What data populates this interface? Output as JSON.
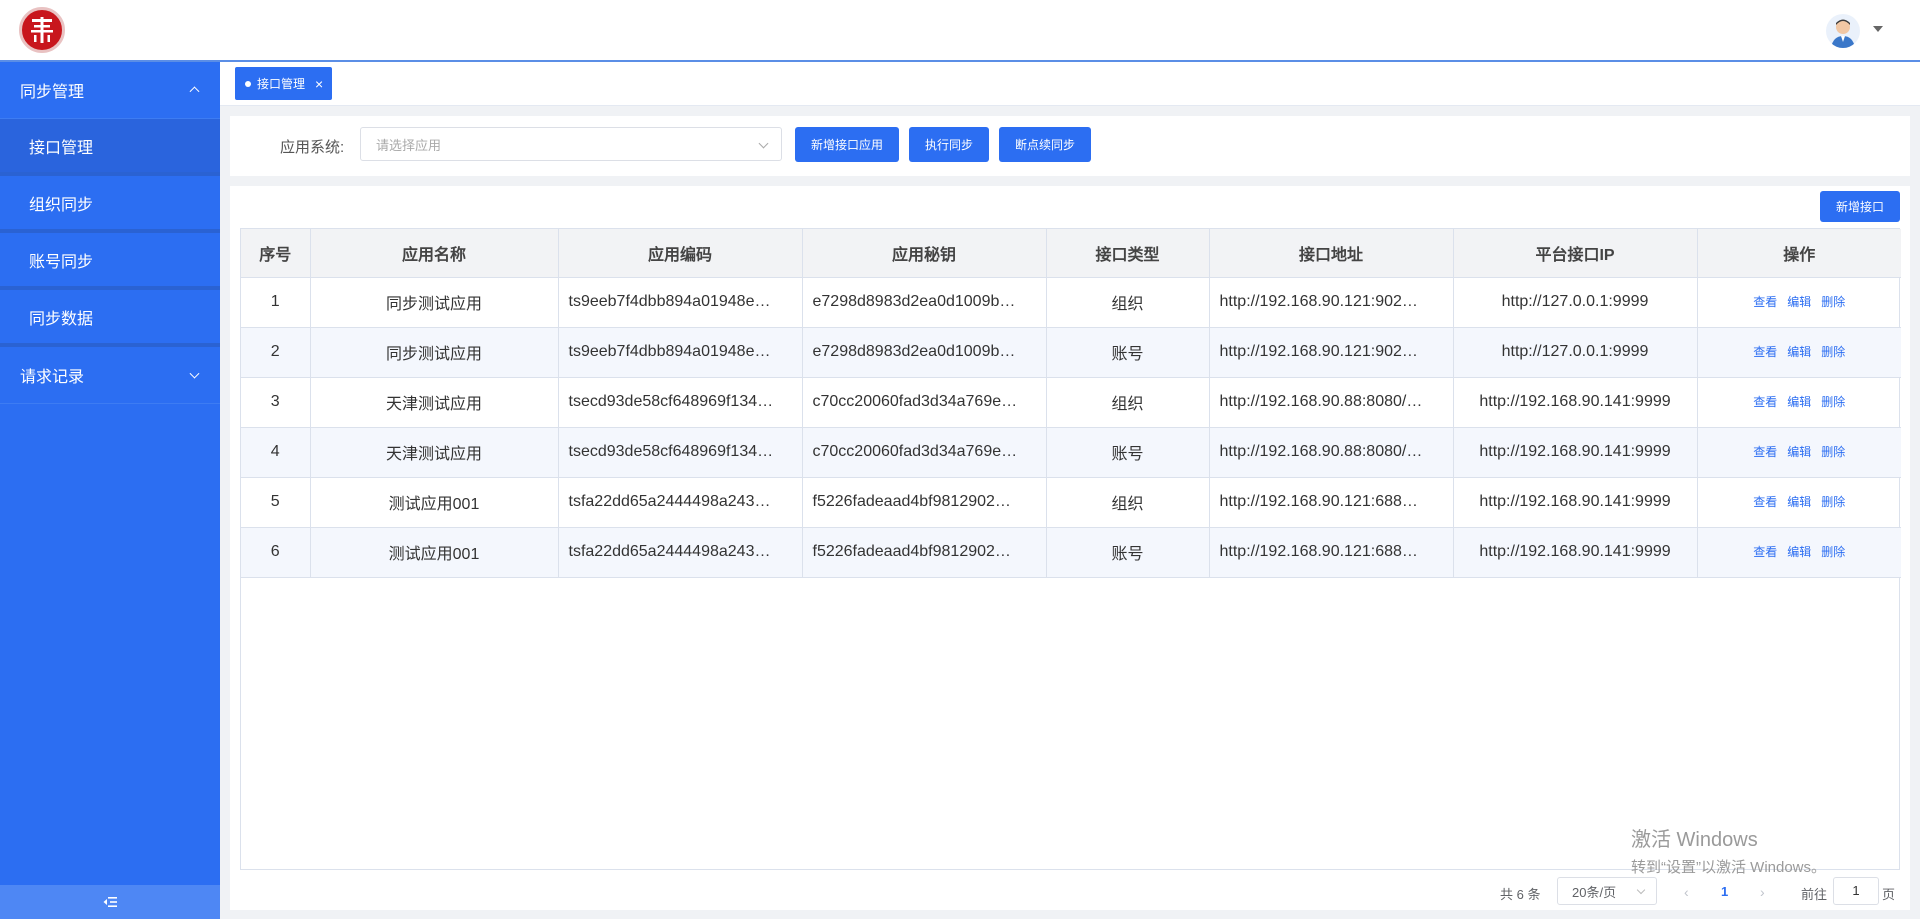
{
  "sidebar": {
    "groups": [
      {
        "label": "同步管理",
        "expanded": true,
        "items": [
          {
            "label": "接口管理",
            "active": true
          },
          {
            "label": "组织同步"
          },
          {
            "label": "账号同步"
          },
          {
            "label": "同步数据"
          }
        ]
      },
      {
        "label": "请求记录",
        "expanded": false
      }
    ],
    "collapse_icon": "collapse-menu-icon"
  },
  "tabs": [
    {
      "label": "接口管理",
      "close": "×"
    }
  ],
  "filter": {
    "label": "应用系统:",
    "select_placeholder": "请选择应用",
    "buttons": {
      "add_app": "新增接口应用",
      "run_sync": "执行同步",
      "resume_sync": "断点续同步"
    }
  },
  "toolbar": {
    "add_interface": "新增接口"
  },
  "table": {
    "columns": [
      "序号",
      "应用名称",
      "应用编码",
      "应用秘钥",
      "接口类型",
      "接口地址",
      "平台接口IP",
      "操作"
    ],
    "rows": [
      {
        "no": "1",
        "name": "同步测试应用",
        "code": "ts9eeb7f4dbb894a01948e…",
        "secret": "e7298d8983d2ea0d1009b…",
        "type": "组织",
        "url": "http://192.168.90.121:902…",
        "ip": "http://127.0.0.1:9999"
      },
      {
        "no": "2",
        "name": "同步测试应用",
        "code": "ts9eeb7f4dbb894a01948e…",
        "secret": "e7298d8983d2ea0d1009b…",
        "type": "账号",
        "url": "http://192.168.90.121:902…",
        "ip": "http://127.0.0.1:9999"
      },
      {
        "no": "3",
        "name": "天津测试应用",
        "code": "tsecd93de58cf648969f134…",
        "secret": "c70cc20060fad3d34a769e…",
        "type": "组织",
        "url": "http://192.168.90.88:8080/…",
        "ip": "http://192.168.90.141:9999"
      },
      {
        "no": "4",
        "name": "天津测试应用",
        "code": "tsecd93de58cf648969f134…",
        "secret": "c70cc20060fad3d34a769e…",
        "type": "账号",
        "url": "http://192.168.90.88:8080/…",
        "ip": "http://192.168.90.141:9999"
      },
      {
        "no": "5",
        "name": "测试应用001",
        "code": "tsfa22dd65a2444498a243…",
        "secret": "f5226fadeaad4bf9812902…",
        "type": "组织",
        "url": "http://192.168.90.121:688…",
        "ip": "http://192.168.90.141:9999"
      },
      {
        "no": "6",
        "name": "测试应用001",
        "code": "tsfa22dd65a2444498a243…",
        "secret": "f5226fadeaad4bf9812902…",
        "type": "账号",
        "url": "http://192.168.90.121:688…",
        "ip": "http://192.168.90.141:9999"
      }
    ],
    "actions": {
      "view": "查看",
      "edit": "编辑",
      "delete": "删除"
    }
  },
  "watermark": {
    "line1": "激活 Windows",
    "line2": "转到“设置”以激活 Windows。"
  },
  "pagination": {
    "total": "共 6 条",
    "page_size": "20条/页",
    "prev": "‹",
    "current_page": "1",
    "next": "›",
    "goto_label": "前往",
    "goto_value": "1",
    "goto_unit": "页"
  },
  "colors": {
    "primary": "#2c6ef2",
    "sidebar": "#2c6ef2",
    "logo_red": "#c8161d"
  }
}
